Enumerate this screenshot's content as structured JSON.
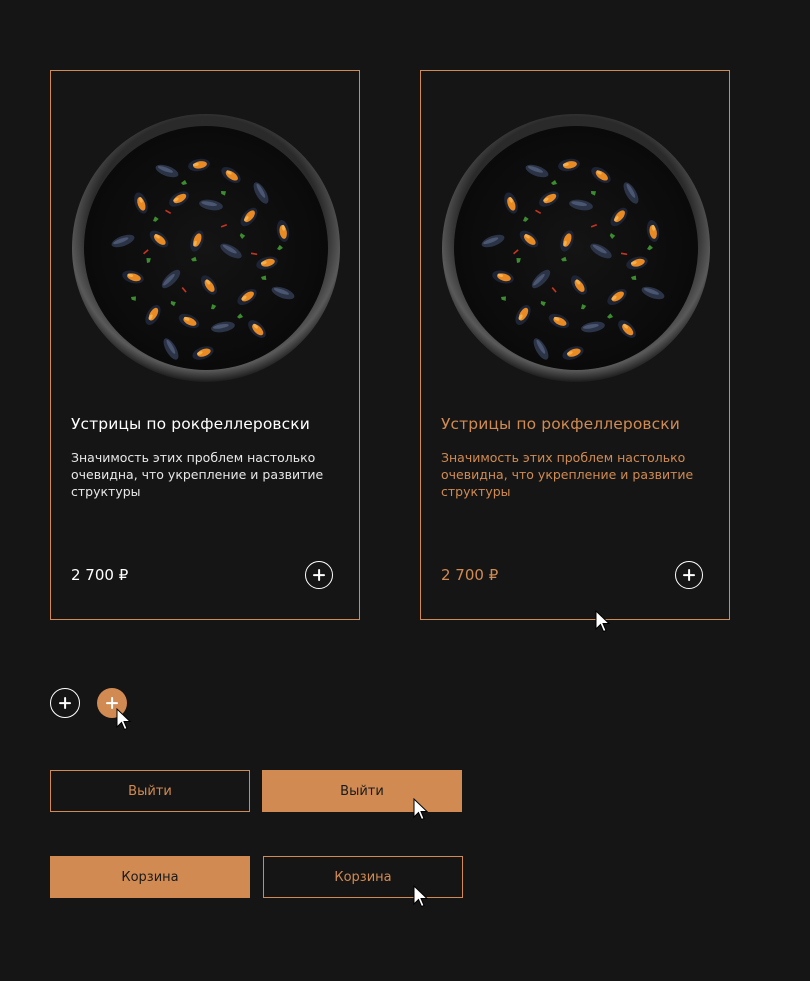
{
  "colors": {
    "background": "#151515",
    "accent": "#d18b52",
    "text": "#ffffff"
  },
  "cards": [
    {
      "title": "Устрицы по рокфеллеровски",
      "description": "Значимость этих проблем настолько очевидна, что укрепление и развитие структуры",
      "price": "2 700 ₽",
      "state": "default"
    },
    {
      "title": "Устрицы по рокфеллеровски",
      "description": "Значимость этих проблем настолько очевидна, что укрепление и развитие структуры",
      "price": "2 700 ₽",
      "state": "hover"
    }
  ],
  "add_buttons": {
    "icon": "plus-icon",
    "states": [
      "default",
      "hover"
    ]
  },
  "logout_buttons": {
    "default_label": "Выйти",
    "hover_label": "Выйти"
  },
  "cart_buttons": {
    "default_label": "Корзина",
    "hover_label": "Корзина"
  }
}
